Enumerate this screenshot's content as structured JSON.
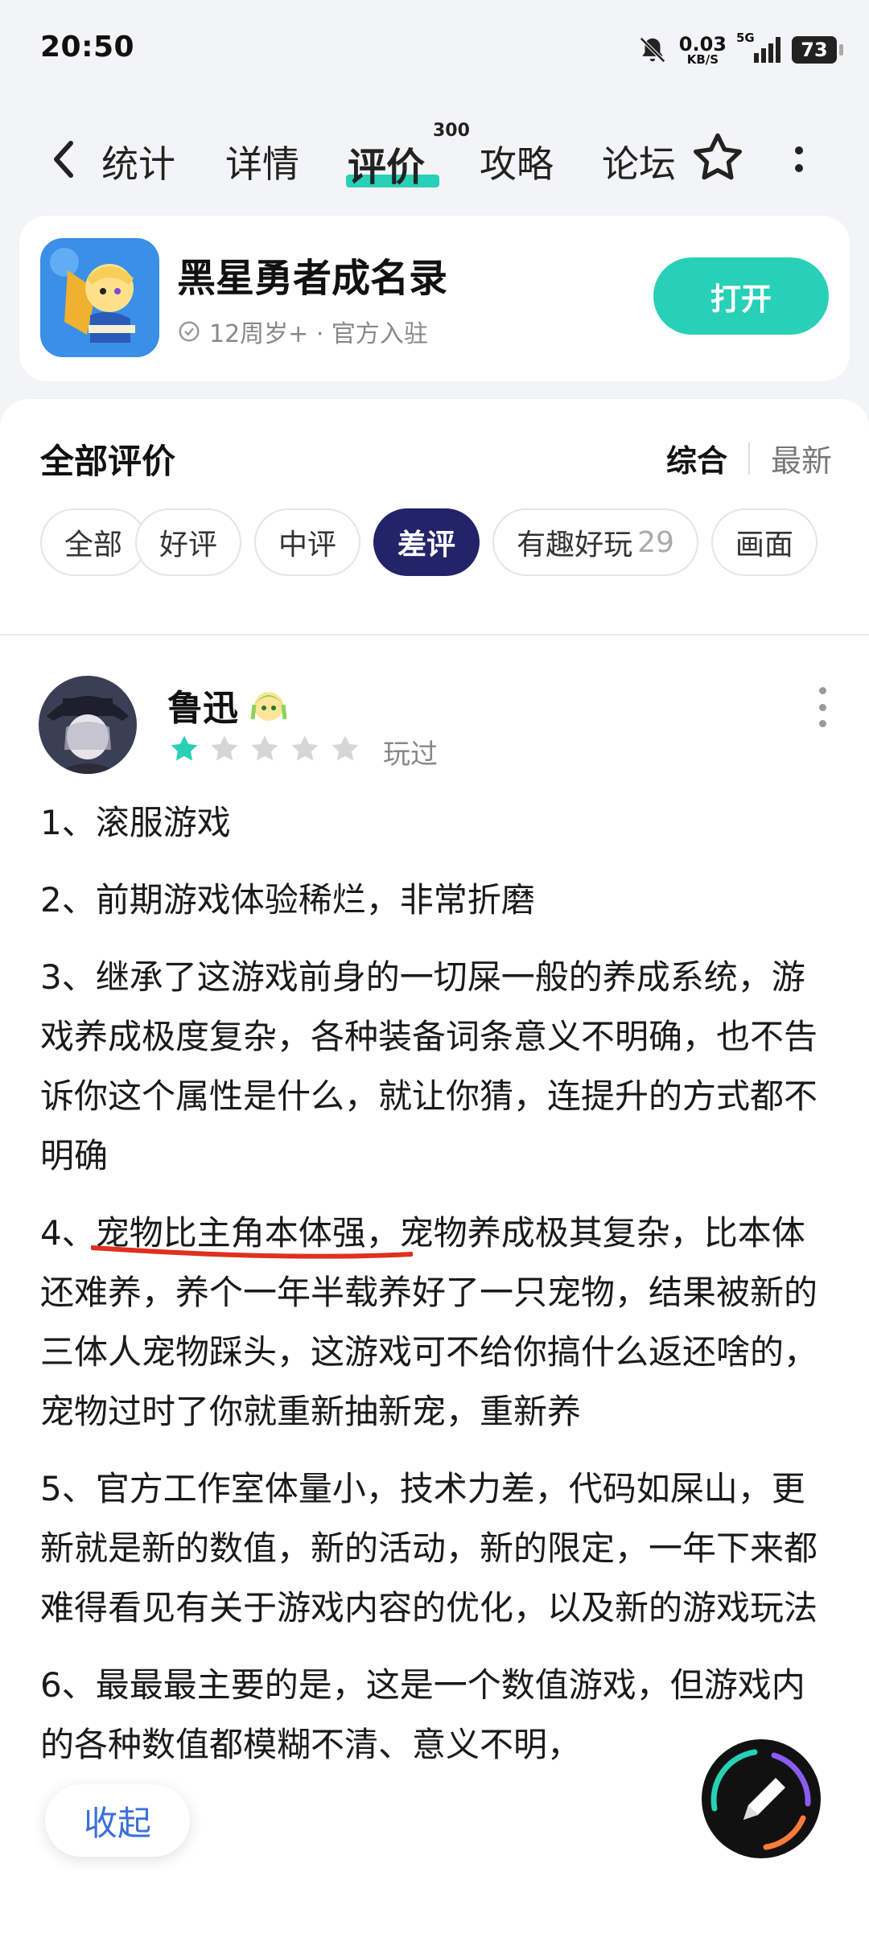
{
  "status_bar": {
    "time": "20:50",
    "net_speed": "0.03",
    "net_unit": "KB/S",
    "network": "5G",
    "battery": "73"
  },
  "nav": {
    "tabs": [
      "统计",
      "详情",
      "评价",
      "攻略",
      "论坛"
    ],
    "active_tab": "评价",
    "review_count_badge": "300"
  },
  "game": {
    "title": "黑星勇者成名录",
    "subtitle": "12周岁+ · 官方入驻",
    "open_label": "打开"
  },
  "reviews_header": {
    "title": "全部评价",
    "sort_active": "综合",
    "sort_other": "最新"
  },
  "filters": [
    {
      "label": "全部",
      "count": ""
    },
    {
      "label": "好评",
      "count": ""
    },
    {
      "label": "中评",
      "count": ""
    },
    {
      "label": "差评",
      "count": ""
    },
    {
      "label": "有趣好玩",
      "count": "29"
    },
    {
      "label": "画面",
      "count": ""
    }
  ],
  "active_filter": "差评",
  "review": {
    "username": "鲁迅",
    "rating": 1,
    "rating_max": 5,
    "status": "玩过",
    "paragraphs": {
      "p1": "1、滚服游戏",
      "p2": "2、前期游戏体验稀烂，非常折磨",
      "p3": "3、继承了这游戏前身的一切屎一般的养成系统，游戏养成极度复杂，各种装备词条意义不明确，也不告诉你这个属性是什么，就让你猜，连提升的方式都不明确",
      "p4_prefix": "4、",
      "p4_underlined": "宠物比主角本体强，宠物养",
      "p4_rest": "成极其复杂，比本体还难养，养个一年半载养好了一只宠物，结果被新的三体人宠物踩头，这游戏可不给你搞什么返还啥的，宠物过时了你就重新抽新宠，重新养",
      "p5": "5、官方工作室体量小，技术力差，代码如屎山，更新就是新的数值，新的活动，新的限定，一年下来都难得看见有关于游戏内容的优化，以及新的游戏玩法",
      "p6": "6、最最最主要的是，这是一个数值游戏，但游戏内的各种数值都模糊不清、意义不明，"
    }
  },
  "collapse_label": "收起",
  "colors": {
    "accent": "#27d0b6",
    "chip_active": "#23236a",
    "underline_mark": "#e0301e",
    "star_on": "#27d0b6",
    "star_off": "#d6d6d6"
  }
}
